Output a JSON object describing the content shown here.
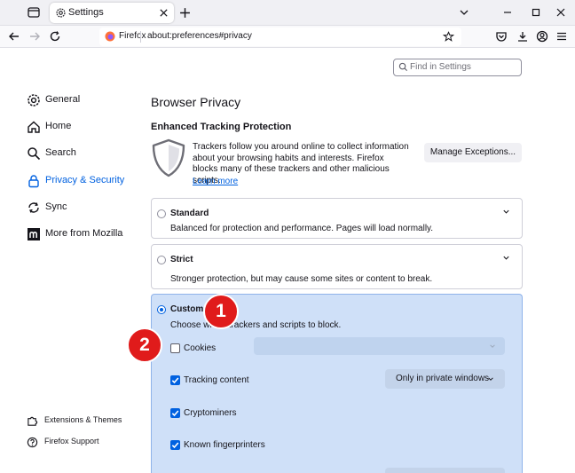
{
  "tabbar": {
    "tab_title": "Settings"
  },
  "navbar": {
    "brand": "Firefox",
    "url": "about:preferences#privacy"
  },
  "search": {
    "placeholder": "Find in Settings"
  },
  "sidebar": {
    "items": [
      {
        "label": "General",
        "icon": "gear-icon"
      },
      {
        "label": "Home",
        "icon": "home-icon"
      },
      {
        "label": "Search",
        "icon": "search-icon"
      },
      {
        "label": "Privacy & Security",
        "icon": "lock-icon",
        "selected": true
      },
      {
        "label": "Sync",
        "icon": "sync-icon"
      },
      {
        "label": "More from Mozilla",
        "icon": "mozilla-icon"
      }
    ],
    "footer": [
      {
        "label": "Extensions & Themes",
        "icon": "puzzle-icon"
      },
      {
        "label": "Firefox Support",
        "icon": "help-icon"
      }
    ]
  },
  "main": {
    "title": "Browser Privacy",
    "etp": {
      "heading": "Enhanced Tracking Protection",
      "description": "Trackers follow you around online to collect information about your browsing habits and interests. Firefox blocks many of these trackers and other malicious scripts.",
      "learn_more": "Learn more",
      "manage_button": "Manage Exceptions..."
    },
    "options": {
      "standard": {
        "title": "Standard",
        "description": "Balanced for protection and performance. Pages will load normally."
      },
      "strict": {
        "title": "Strict",
        "description": "Stronger protection, but may cause some sites or content to break."
      },
      "custom": {
        "title": "Custom",
        "description": "Choose which trackers and scripts to block.",
        "selected": true,
        "items": [
          {
            "label": "Cookies",
            "checked": false
          },
          {
            "label": "Tracking content",
            "checked": true,
            "select": "Only in private windows"
          },
          {
            "label": "Cryptominers",
            "checked": true
          },
          {
            "label": "Known fingerprinters",
            "checked": true
          }
        ]
      }
    }
  },
  "annotations": {
    "badge_1": "1",
    "badge_2": "2"
  },
  "colors": {
    "accent": "#0061e0",
    "custom_bg": "#cfe0f8",
    "badge": "#e01b1b"
  }
}
